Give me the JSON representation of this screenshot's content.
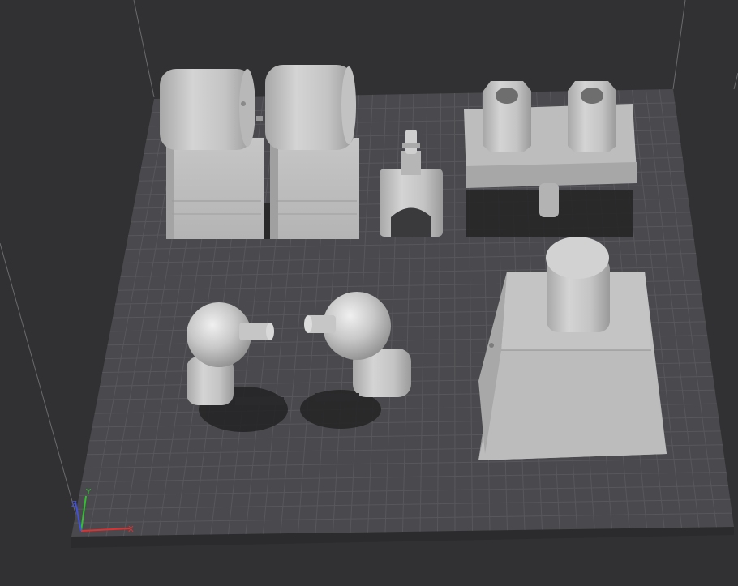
{
  "viewport": {
    "background_color": "#313133",
    "bed_color": "#4a4a4e",
    "bed_edge_color": "#2e2e30",
    "grid_color": "#5c5c60",
    "model_color": "#c9c9c9",
    "shadow_color": "#1e1e20"
  },
  "axes": {
    "x_label": "X",
    "y_label": "Y",
    "z_label": "Z",
    "x_color": "#e03030",
    "y_color": "#30c030",
    "z_color": "#4050e0"
  },
  "models": [
    {
      "name": "block-left",
      "type": "cylinder-on-block"
    },
    {
      "name": "block-right",
      "type": "cylinder-on-block"
    },
    {
      "name": "clip-pin",
      "type": "clip-with-peg"
    },
    {
      "name": "double-hex-bracket",
      "type": "plate-with-hex-nuts"
    },
    {
      "name": "elbow-left",
      "type": "elbow-pipe"
    },
    {
      "name": "elbow-right",
      "type": "elbow-pipe"
    },
    {
      "name": "torso",
      "type": "trapezoid-with-neck"
    }
  ]
}
